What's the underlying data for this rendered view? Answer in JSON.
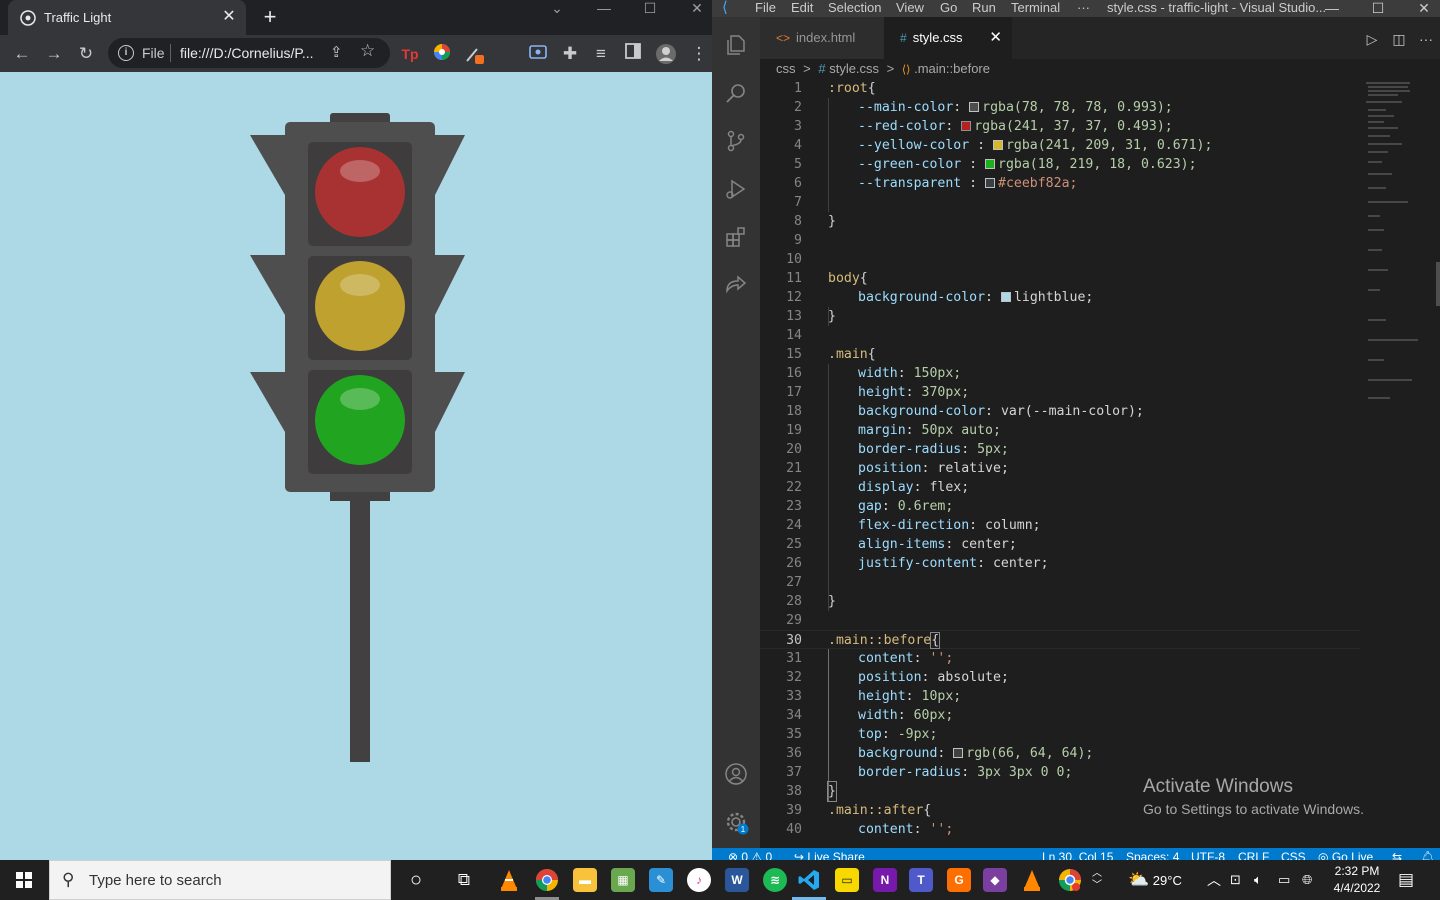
{
  "browser": {
    "tab_title": "Traffic Light",
    "tab_close": "✕",
    "new_tab": "+",
    "url_scheme": "File",
    "url": "file:///D:/Cornelius/P...",
    "page": {
      "background_color": "#add8e6",
      "light_colors": {
        "red": "#a83232",
        "yellow": "#bea12e",
        "green": "#21a521",
        "housing": "#4e4e4e",
        "lamp_box": "#3e3c3d",
        "pole": "#424040"
      }
    }
  },
  "vscode": {
    "menu": [
      "File",
      "Edit",
      "Selection",
      "View",
      "Go",
      "Run",
      "Terminal",
      "···"
    ],
    "window_title": "style.css - traffic-light - Visual Studio...",
    "tabs": [
      {
        "icon": "<>",
        "label": "index.html"
      },
      {
        "icon": "#",
        "label": "style.css",
        "close": "✕"
      }
    ],
    "breadcrumb": {
      "folder": "css",
      "sep1": ">",
      "file_icon": "#",
      "file": "style.css",
      "sep2": ">",
      "symbol_icon": "⟨⟩",
      "symbol": ".main::before"
    },
    "current_line": 30,
    "line_numbers": [
      "1",
      "2",
      "3",
      "4",
      "5",
      "6",
      "7",
      "8",
      "9",
      "10",
      "11",
      "12",
      "13",
      "14",
      "15",
      "16",
      "17",
      "18",
      "19",
      "20",
      "21",
      "22",
      "23",
      "24",
      "25",
      "26",
      "27",
      "28",
      "29",
      "30",
      "31",
      "32",
      "33",
      "34",
      "35",
      "36",
      "37",
      "38",
      "39",
      "40"
    ],
    "code": {
      "l1_sel": ":root",
      "l1_p": "{",
      "l2_prop": "--main-color",
      "l2_val": "rgba(78, 78, 78, 0.993);",
      "l3_prop": "--red-color",
      "l3_val": "rgba(241, 37, 37, 0.493);",
      "l4_prop": "--yellow-color",
      "l4_val": "rgba(241, 209, 31, 0.671);",
      "l5_prop": "--green-color",
      "l5_val": "rgba(18, 219, 18, 0.623);",
      "l6_prop": "--transparent",
      "l6_val": "#ceebf82a;",
      "l8": "}",
      "l11_sel": "body",
      "l11_p": "{",
      "l12_prop": "background-color",
      "l12_val": "lightblue;",
      "l13": "}",
      "l15_sel": ".main",
      "l15_p": "{",
      "l16_prop": "width",
      "l16_val": "150px;",
      "l17_prop": "height",
      "l17_val": "370px;",
      "l18_prop": "background-color",
      "l18_val": "var(--main-color);",
      "l19_prop": "margin",
      "l19_val": "50px auto;",
      "l20_prop": "border-radius",
      "l20_val": "5px;",
      "l21_prop": "position",
      "l21_val": "relative;",
      "l22_prop": "display",
      "l22_val": "flex;",
      "l23_prop": "gap",
      "l23_val": "0.6rem;",
      "l24_prop": "flex-direction",
      "l24_val": "column;",
      "l25_prop": "align-items",
      "l25_val": "center;",
      "l26_prop": "justify-content",
      "l26_val": "center;",
      "l28": "}",
      "l30_sel": ".main::before",
      "l30_p": "{",
      "l31_prop": "content",
      "l31_val": "'';",
      "l32_prop": "position",
      "l32_val": "absolute;",
      "l33_prop": "height",
      "l33_val": "10px;",
      "l34_prop": "width",
      "l34_val": "60px;",
      "l35_prop": "top",
      "l35_val": "-9px;",
      "l36_prop": "background",
      "l36_val": "rgb(66, 64, 64);",
      "l37_prop": "border-radius",
      "l37_val": "3px 3px 0 0;",
      "l38": "}",
      "l39_sel": ".main::after",
      "l39_p": "{",
      "l40_prop": "content",
      "l40_val": "'';"
    },
    "swatches": {
      "main": "#4e4e4e",
      "red": "#f12525",
      "yellow": "#f1d11f",
      "green": "#12db12",
      "transparent": "#ceebf8",
      "lightblue": "#add8e6",
      "rgb66": "#424040"
    },
    "activate_title": "Activate Windows",
    "activate_sub": "Go to Settings to activate Windows.",
    "status": {
      "errors": "⊗ 0 ⚠ 0",
      "live_share": "Live Share",
      "position": "Ln 30, Col 15",
      "spaces": "Spaces: 4",
      "encoding": "UTF-8",
      "eol": "CRLF",
      "language": "CSS",
      "go_live": "Go Live"
    },
    "accent_color": "#007acc"
  },
  "taskbar": {
    "search_placeholder": "Type here to search",
    "weather": "29°C",
    "time": "2:32 PM",
    "date": "4/4/2022"
  }
}
